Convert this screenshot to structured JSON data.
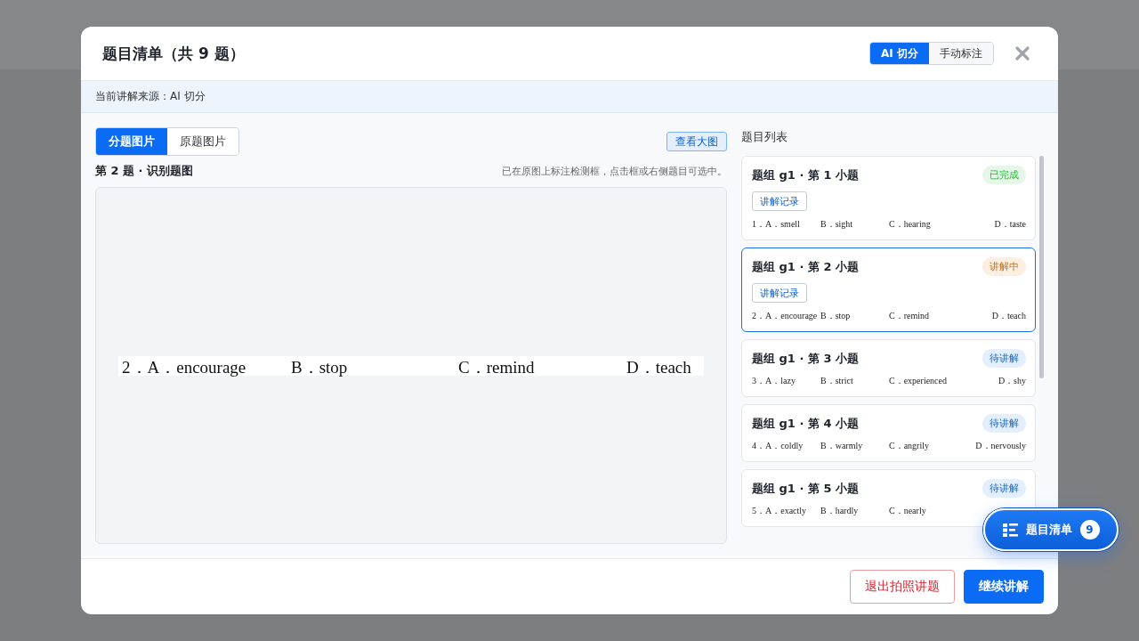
{
  "dialog": {
    "title": "题目清单（共 9 题）",
    "source_modes": [
      {
        "label": "AI 切分",
        "selected": true
      },
      {
        "label": "手动标注",
        "selected": false
      }
    ]
  },
  "source_bar": {
    "text": "当前讲解来源：AI 切分"
  },
  "image_tabs": [
    {
      "label": "分题图片",
      "selected": true
    },
    {
      "label": "原题图片",
      "selected": false
    }
  ],
  "view_large_button": "查看大图",
  "preview": {
    "heading": "第 2 题 · 识别题图",
    "hint": "已在原图上标注检测框，点击框或右侧题目可选中。",
    "options": [
      "2．A．encourage",
      "B．stop",
      "C．remind",
      "D．teach"
    ]
  },
  "question_list": {
    "heading": "题目列表",
    "items": [
      {
        "title": "题组 g1 · 第 1 小题",
        "status": {
          "text": "已完成",
          "color": "#e6f6e8"
        },
        "selected": false,
        "record_button": "讲解记录",
        "options": [
          "1．A．smell",
          "B．sight",
          "C．hearing",
          "D．taste"
        ]
      },
      {
        "title": "题组 g1 · 第 2 小题",
        "status": {
          "text": "讲解中",
          "color": "#fdefe0"
        },
        "selected": true,
        "record_button": "讲解记录",
        "options": [
          "2．A．encourage",
          "B．stop",
          "C．remind",
          "D．teach"
        ]
      },
      {
        "title": "题组 g1 · 第 3 小题",
        "status": {
          "text": "待讲解",
          "color": "#e3effd"
        },
        "selected": false,
        "options": [
          "3．A．lazy",
          "B．strict",
          "C．experienced",
          "D．shy"
        ]
      },
      {
        "title": "题组 g1 · 第 4 小题",
        "status": {
          "text": "待讲解",
          "color": "#e3effd"
        },
        "selected": false,
        "options": [
          "4．A．coldly",
          "B．warmly",
          "C．angrily",
          "D．nervously"
        ]
      },
      {
        "title": "题组 g1 · 第 5 小题",
        "status": {
          "text": "待讲解",
          "color": "#e3effd"
        },
        "selected": false,
        "options": [
          "5．A．exactly",
          "B．hardly",
          "C．nearly"
        ]
      }
    ]
  },
  "footer_buttons": [
    {
      "label": "退出拍照讲题",
      "kind": "danger"
    },
    {
      "label": "继续讲解",
      "kind": "primary"
    }
  ],
  "floating_button": {
    "label": "题目清单",
    "count": "9"
  }
}
